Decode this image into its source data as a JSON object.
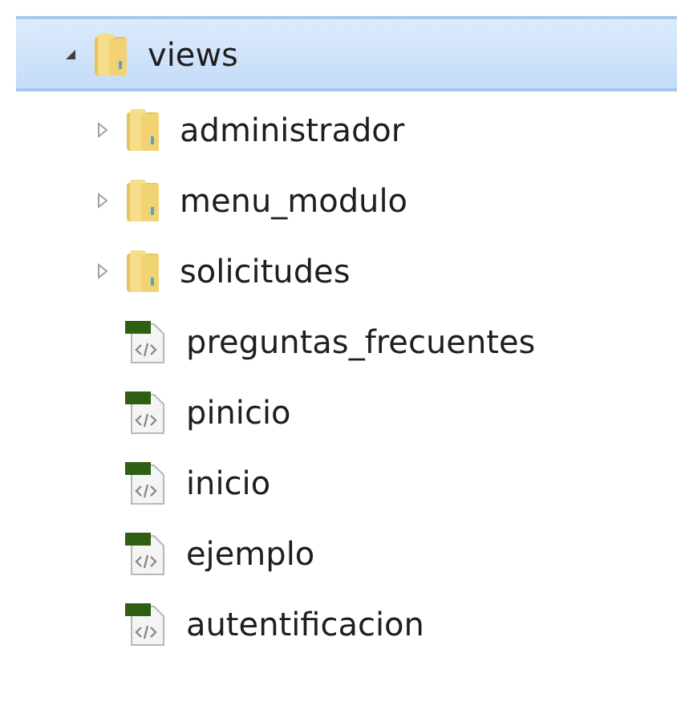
{
  "tree": [
    {
      "label": "views",
      "kind": "folder",
      "expanded": true,
      "selected": true,
      "children": [
        {
          "label": "administrador",
          "kind": "folder",
          "expanded": false,
          "selected": false
        },
        {
          "label": "menu_modulo",
          "kind": "folder",
          "expanded": false,
          "selected": false
        },
        {
          "label": "solicitudes",
          "kind": "folder",
          "expanded": false,
          "selected": false
        },
        {
          "label": "preguntas_frecuentes",
          "kind": "file",
          "selected": false
        },
        {
          "label": "pinicio",
          "kind": "file",
          "selected": false
        },
        {
          "label": "inicio",
          "kind": "file",
          "selected": false
        },
        {
          "label": "ejemplo",
          "kind": "file",
          "selected": false
        },
        {
          "label": "autentificacion",
          "kind": "file",
          "selected": false
        }
      ]
    }
  ]
}
